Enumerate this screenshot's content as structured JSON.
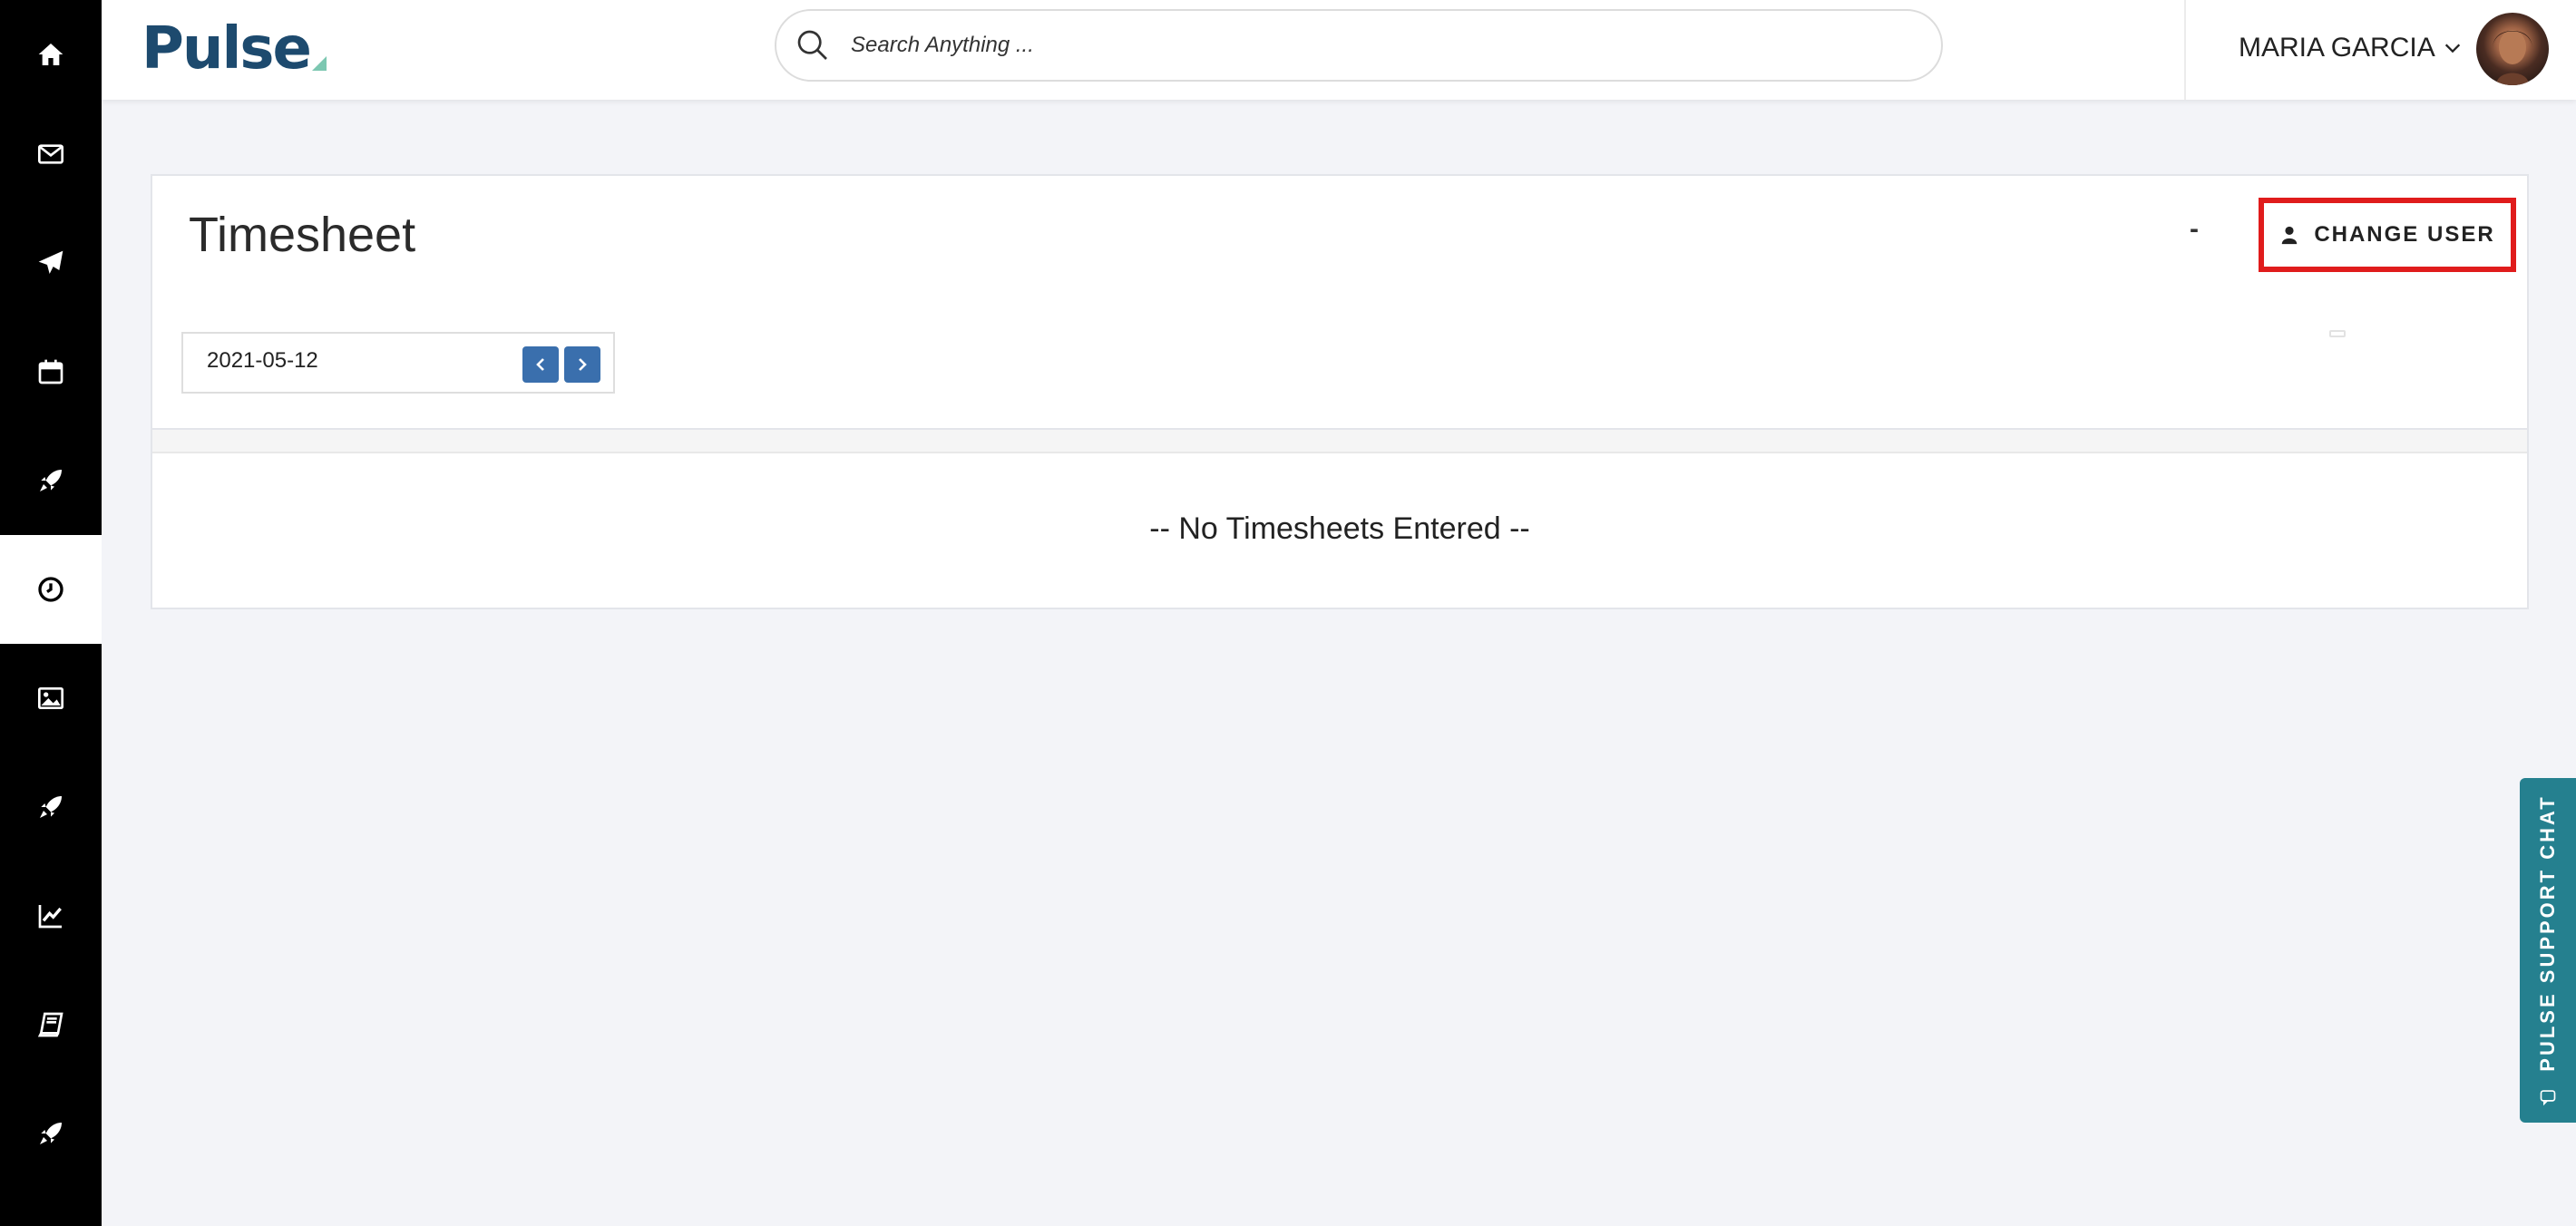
{
  "app": {
    "logo_text": "Pulse"
  },
  "sidebar": {
    "items": [
      {
        "icon": "home-icon"
      },
      {
        "icon": "mail-icon"
      },
      {
        "icon": "paper-plane-icon"
      },
      {
        "icon": "calendar-icon"
      },
      {
        "icon": "rocket-icon"
      },
      {
        "icon": "clock-icon",
        "active": true
      },
      {
        "icon": "image-icon"
      },
      {
        "icon": "rocket-icon"
      },
      {
        "icon": "chart-line-icon"
      },
      {
        "icon": "book-icon"
      },
      {
        "icon": "rocket-icon"
      }
    ]
  },
  "header": {
    "search_placeholder": "Search Anything ...",
    "user_name": "MARIA GARCIA"
  },
  "timesheet": {
    "title": "Timesheet",
    "dash": "-",
    "change_user_label": "CHANGE USER",
    "date_value": "2021-05-12",
    "empty_message": "-- No Timesheets Entered --"
  },
  "support": {
    "label": "PULSE SUPPORT CHAT"
  },
  "colors": {
    "sidebar_bg": "#000000",
    "brand": "#1d4a6e",
    "accent_button": "#3a6fad",
    "highlight": "#e01c1c",
    "support_tab": "#25808f"
  }
}
